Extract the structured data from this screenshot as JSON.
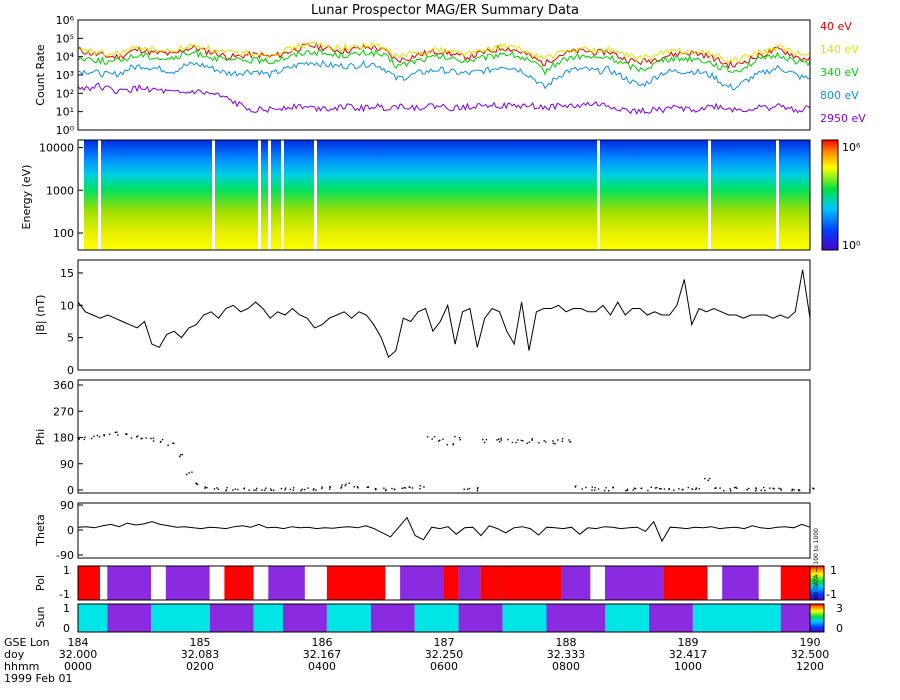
{
  "title": "Lunar Prospector MAG/ER Summary Data",
  "colors": {
    "axis": "#000000",
    "e40": "#e00000",
    "e140": "#e0e000",
    "e340": "#00d000",
    "e800": "#1090e0",
    "e2950": "#8000e0",
    "pol_pos": "#ff0000",
    "pol_neg": "#8a2be2",
    "sun_a": "#00e5e5",
    "sun_b": "#8a2be2"
  },
  "chart_data": [
    {
      "type": "line",
      "name": "count-rate",
      "ylabel": "Count Rate",
      "yscale": "log",
      "ylim": [
        1,
        1000000
      ],
      "yticks": [
        "10⁰",
        "10¹",
        "10²",
        "10³",
        "10⁴",
        "10⁵",
        "10⁶"
      ],
      "series": [
        {
          "name": "40 eV",
          "color": "#e00000",
          "level": [
            4.4,
            4.2,
            4.1,
            4.0,
            4.0,
            4.3,
            4.4,
            4.2,
            4.2,
            4.1,
            4.4,
            4.5,
            4.3,
            4.2,
            4.0,
            4.0,
            4.1,
            4.1,
            4.0,
            4.1,
            4.3,
            4.5,
            4.6,
            4.5,
            4.4,
            4.3,
            4.4,
            4.5,
            4.5,
            4.3,
            3.8,
            3.9,
            4.1,
            4.2,
            4.3,
            4.2,
            4.0,
            4.0,
            4.2,
            4.3,
            4.5,
            4.4,
            4.2,
            3.9,
            3.6,
            4.0,
            4.2,
            4.3,
            4.3,
            4.2,
            4.3,
            4.0,
            3.8,
            3.7,
            3.8,
            4.0,
            4.1,
            4.2,
            4.2,
            4.1,
            3.9,
            3.6,
            3.5,
            3.8,
            4.0,
            4.2,
            4.4,
            4.2,
            3.9,
            3.9
          ]
        },
        {
          "name": "140 eV",
          "color": "#e0e000",
          "level": [
            4.3,
            4.3,
            4.2,
            4.1,
            4.2,
            4.4,
            4.5,
            4.4,
            4.3,
            4.3,
            4.5,
            4.6,
            4.5,
            4.3,
            4.2,
            4.2,
            4.2,
            4.2,
            4.1,
            4.3,
            4.4,
            4.6,
            4.7,
            4.6,
            4.5,
            4.5,
            4.5,
            4.6,
            4.6,
            4.4,
            4.0,
            4.1,
            4.2,
            4.3,
            4.4,
            4.3,
            4.2,
            4.2,
            4.3,
            4.4,
            4.6,
            4.5,
            4.3,
            4.1,
            3.9,
            4.1,
            4.3,
            4.4,
            4.4,
            4.3,
            4.4,
            4.2,
            4.0,
            3.9,
            4.0,
            4.2,
            4.3,
            4.3,
            4.3,
            4.2,
            4.1,
            3.8,
            3.8,
            4.0,
            4.2,
            4.3,
            4.5,
            4.3,
            4.1,
            4.1
          ]
        },
        {
          "name": "340 eV",
          "color": "#00d000",
          "level": [
            3.9,
            3.9,
            3.8,
            3.7,
            3.8,
            4.0,
            4.1,
            4.0,
            3.9,
            3.9,
            4.1,
            4.2,
            4.1,
            3.9,
            3.8,
            3.8,
            3.8,
            3.8,
            3.7,
            3.9,
            4.0,
            4.2,
            4.3,
            4.2,
            4.1,
            4.1,
            4.1,
            4.2,
            4.2,
            4.0,
            3.5,
            3.6,
            3.8,
            3.9,
            4.0,
            3.9,
            3.8,
            3.8,
            3.9,
            4.0,
            4.2,
            4.1,
            3.9,
            3.6,
            3.2,
            3.6,
            3.9,
            4.0,
            4.0,
            3.9,
            4.0,
            3.7,
            3.5,
            3.3,
            3.5,
            3.8,
            3.9,
            3.9,
            3.9,
            3.8,
            3.6,
            3.3,
            3.2,
            3.5,
            3.8,
            3.9,
            4.1,
            3.9,
            3.7,
            3.7
          ]
        },
        {
          "name": "800 eV",
          "color": "#1090e0",
          "level": [
            3.2,
            3.2,
            3.1,
            3.0,
            3.1,
            3.4,
            3.5,
            3.4,
            3.3,
            3.2,
            3.5,
            3.6,
            3.5,
            3.3,
            3.1,
            3.1,
            3.2,
            3.2,
            3.0,
            3.2,
            3.4,
            3.6,
            3.7,
            3.6,
            3.5,
            3.5,
            3.5,
            3.6,
            3.6,
            3.3,
            2.8,
            2.9,
            3.1,
            3.2,
            3.3,
            3.2,
            3.1,
            3.1,
            3.2,
            3.3,
            3.5,
            3.4,
            3.2,
            2.8,
            2.3,
            2.8,
            3.2,
            3.3,
            3.3,
            3.2,
            3.3,
            3.0,
            2.7,
            2.4,
            2.7,
            3.1,
            3.2,
            3.2,
            3.2,
            3.1,
            2.9,
            2.4,
            2.3,
            2.7,
            3.0,
            3.2,
            3.4,
            3.2,
            2.9,
            2.8
          ]
        },
        {
          "name": "2950 eV",
          "color": "#8000e0",
          "level": [
            2.3,
            2.3,
            2.4,
            2.2,
            2.1,
            2.2,
            2.3,
            2.2,
            2.1,
            2.0,
            2.0,
            2.1,
            2.0,
            1.9,
            1.7,
            1.4,
            1.2,
            1.1,
            1.1,
            1.2,
            1.3,
            1.3,
            1.2,
            1.2,
            1.2,
            1.3,
            1.2,
            1.2,
            1.3,
            1.2,
            1.3,
            1.3,
            1.2,
            1.3,
            1.3,
            1.2,
            1.2,
            1.3,
            1.4,
            1.4,
            1.3,
            1.3,
            1.3,
            1.3,
            1.2,
            1.3,
            1.3,
            1.3,
            1.4,
            1.4,
            1.3,
            1.2,
            1.0,
            1.0,
            1.1,
            1.1,
            1.2,
            1.2,
            1.1,
            1.2,
            1.3,
            1.2,
            1.1,
            1.1,
            1.2,
            1.2,
            1.3,
            1.2,
            1.1,
            1.2
          ]
        }
      ]
    },
    {
      "type": "heatmap",
      "name": "energy-spectrogram",
      "ylabel": "Energy (eV)",
      "yscale": "log",
      "ylim": [
        40,
        15000
      ],
      "yticks": [
        "100",
        "1000",
        "10000"
      ],
      "colorbar_ticks": [
        "10⁰",
        "10⁶"
      ]
    },
    {
      "type": "line",
      "name": "field-magnitude",
      "ylabel": "|B| (nT)",
      "ylim": [
        0,
        17
      ],
      "yticks": [
        "0",
        "5",
        "10",
        "15"
      ],
      "values": [
        10.5,
        9.0,
        8.5,
        8.0,
        8.5,
        8.0,
        7.5,
        7.0,
        6.5,
        7.5,
        4.0,
        3.5,
        5.5,
        6.0,
        5.0,
        6.5,
        7.0,
        8.5,
        9.0,
        8.0,
        9.5,
        10.0,
        9.0,
        9.5,
        10.5,
        9.5,
        8.0,
        9.0,
        8.5,
        9.5,
        8.5,
        8.0,
        6.5,
        7.0,
        8.0,
        8.5,
        9.0,
        8.0,
        9.0,
        8.5,
        7.0,
        5.0,
        2.0,
        3.0,
        8.0,
        7.5,
        9.0,
        9.5,
        6.0,
        7.5,
        10.0,
        4.0,
        9.0,
        9.5,
        3.5,
        8.0,
        9.5,
        9.0,
        6.0,
        4.0,
        10.5,
        3.0,
        9.0,
        9.5,
        9.5,
        10.0,
        9.0,
        9.5,
        9.5,
        9.0,
        9.0,
        10.0,
        8.5,
        10.5,
        8.5,
        9.5,
        9.5,
        8.5,
        9.0,
        8.5,
        8.5,
        10.0,
        14.0,
        7.0,
        9.5,
        9.0,
        9.5,
        9.0,
        8.5,
        8.5,
        8.0,
        8.5,
        8.5,
        8.5,
        8.0,
        8.5,
        8.0,
        9.0,
        15.5,
        8.0
      ]
    },
    {
      "type": "scatter",
      "name": "phi",
      "ylabel": "Phi",
      "ylim": [
        0,
        360
      ],
      "yticks": [
        "0",
        "90",
        "180",
        "270",
        "360"
      ],
      "values": [
        178,
        180,
        185,
        190,
        195,
        190,
        185,
        180,
        175,
        170,
        160,
        120,
        60,
        20,
        10,
        8,
        6,
        5,
        5,
        4,
        4,
        5,
        6,
        5,
        5,
        6,
        8,
        10,
        15,
        20,
        10,
        8,
        6,
        5,
        5,
        6,
        8,
        12,
        180,
        175,
        160,
        180,
        6,
        5,
        170,
        172,
        175,
        170,
        168,
        172,
        170,
        165,
        175,
        170,
        10,
        8,
        5,
        5,
        6,
        5,
        4,
        5,
        6,
        5,
        5,
        6,
        8,
        10,
        40,
        5,
        5,
        6,
        5,
        4,
        5,
        5,
        6,
        5,
        5,
        5
      ]
    },
    {
      "type": "line",
      "name": "theta",
      "ylabel": "Theta",
      "ylim": [
        -90,
        90
      ],
      "yticks": [
        "-90",
        "0",
        "90"
      ],
      "values": [
        10,
        12,
        8,
        15,
        20,
        12,
        25,
        18,
        22,
        30,
        20,
        15,
        10,
        12,
        8,
        5,
        10,
        8,
        5,
        12,
        15,
        10,
        20,
        8,
        10,
        5,
        12,
        8,
        10,
        5,
        8,
        6,
        10,
        12,
        8,
        15,
        5,
        -10,
        -25,
        10,
        45,
        -20,
        -35,
        10,
        5,
        12,
        -15,
        8,
        10,
        -20,
        15,
        5,
        -10,
        8,
        12,
        5,
        -18,
        10,
        8,
        5,
        10,
        -15,
        8,
        5,
        12,
        10,
        5,
        8,
        10,
        -5,
        30,
        -40,
        10,
        8,
        5,
        10,
        8,
        12,
        5,
        8,
        10,
        5,
        15,
        8,
        5,
        10,
        12,
        8,
        20,
        10
      ]
    },
    {
      "type": "heatmap",
      "name": "polarity",
      "ylabel": "Pol",
      "yticks": [
        "1",
        "-1"
      ],
      "colorbar_ticks": [
        "-1",
        "1"
      ],
      "colorbar_label": "NO DATA — 100 to 1000"
    },
    {
      "type": "heatmap",
      "name": "sun",
      "ylabel": "Sun",
      "yticks": [
        "1",
        "0"
      ],
      "colorbar_ticks": [
        "0",
        "3"
      ]
    }
  ],
  "axis_footer": {
    "row_labels": [
      "GSE Lon",
      "doy",
      "hhmm",
      "1999 Feb 01"
    ],
    "ticks": [
      {
        "lon": "184",
        "doy": "32.000",
        "hhmm": "0000"
      },
      {
        "lon": "185",
        "doy": "32.083",
        "hhmm": "0200"
      },
      {
        "lon": "186",
        "doy": "32.167",
        "hhmm": "0400"
      },
      {
        "lon": "187",
        "doy": "32.250",
        "hhmm": "0600"
      },
      {
        "lon": "188",
        "doy": "32.333",
        "hhmm": "0800"
      },
      {
        "lon": "189",
        "doy": "32.417",
        "hhmm": "1000"
      },
      {
        "lon": "190",
        "doy": "32.500",
        "hhmm": "1200"
      }
    ]
  }
}
